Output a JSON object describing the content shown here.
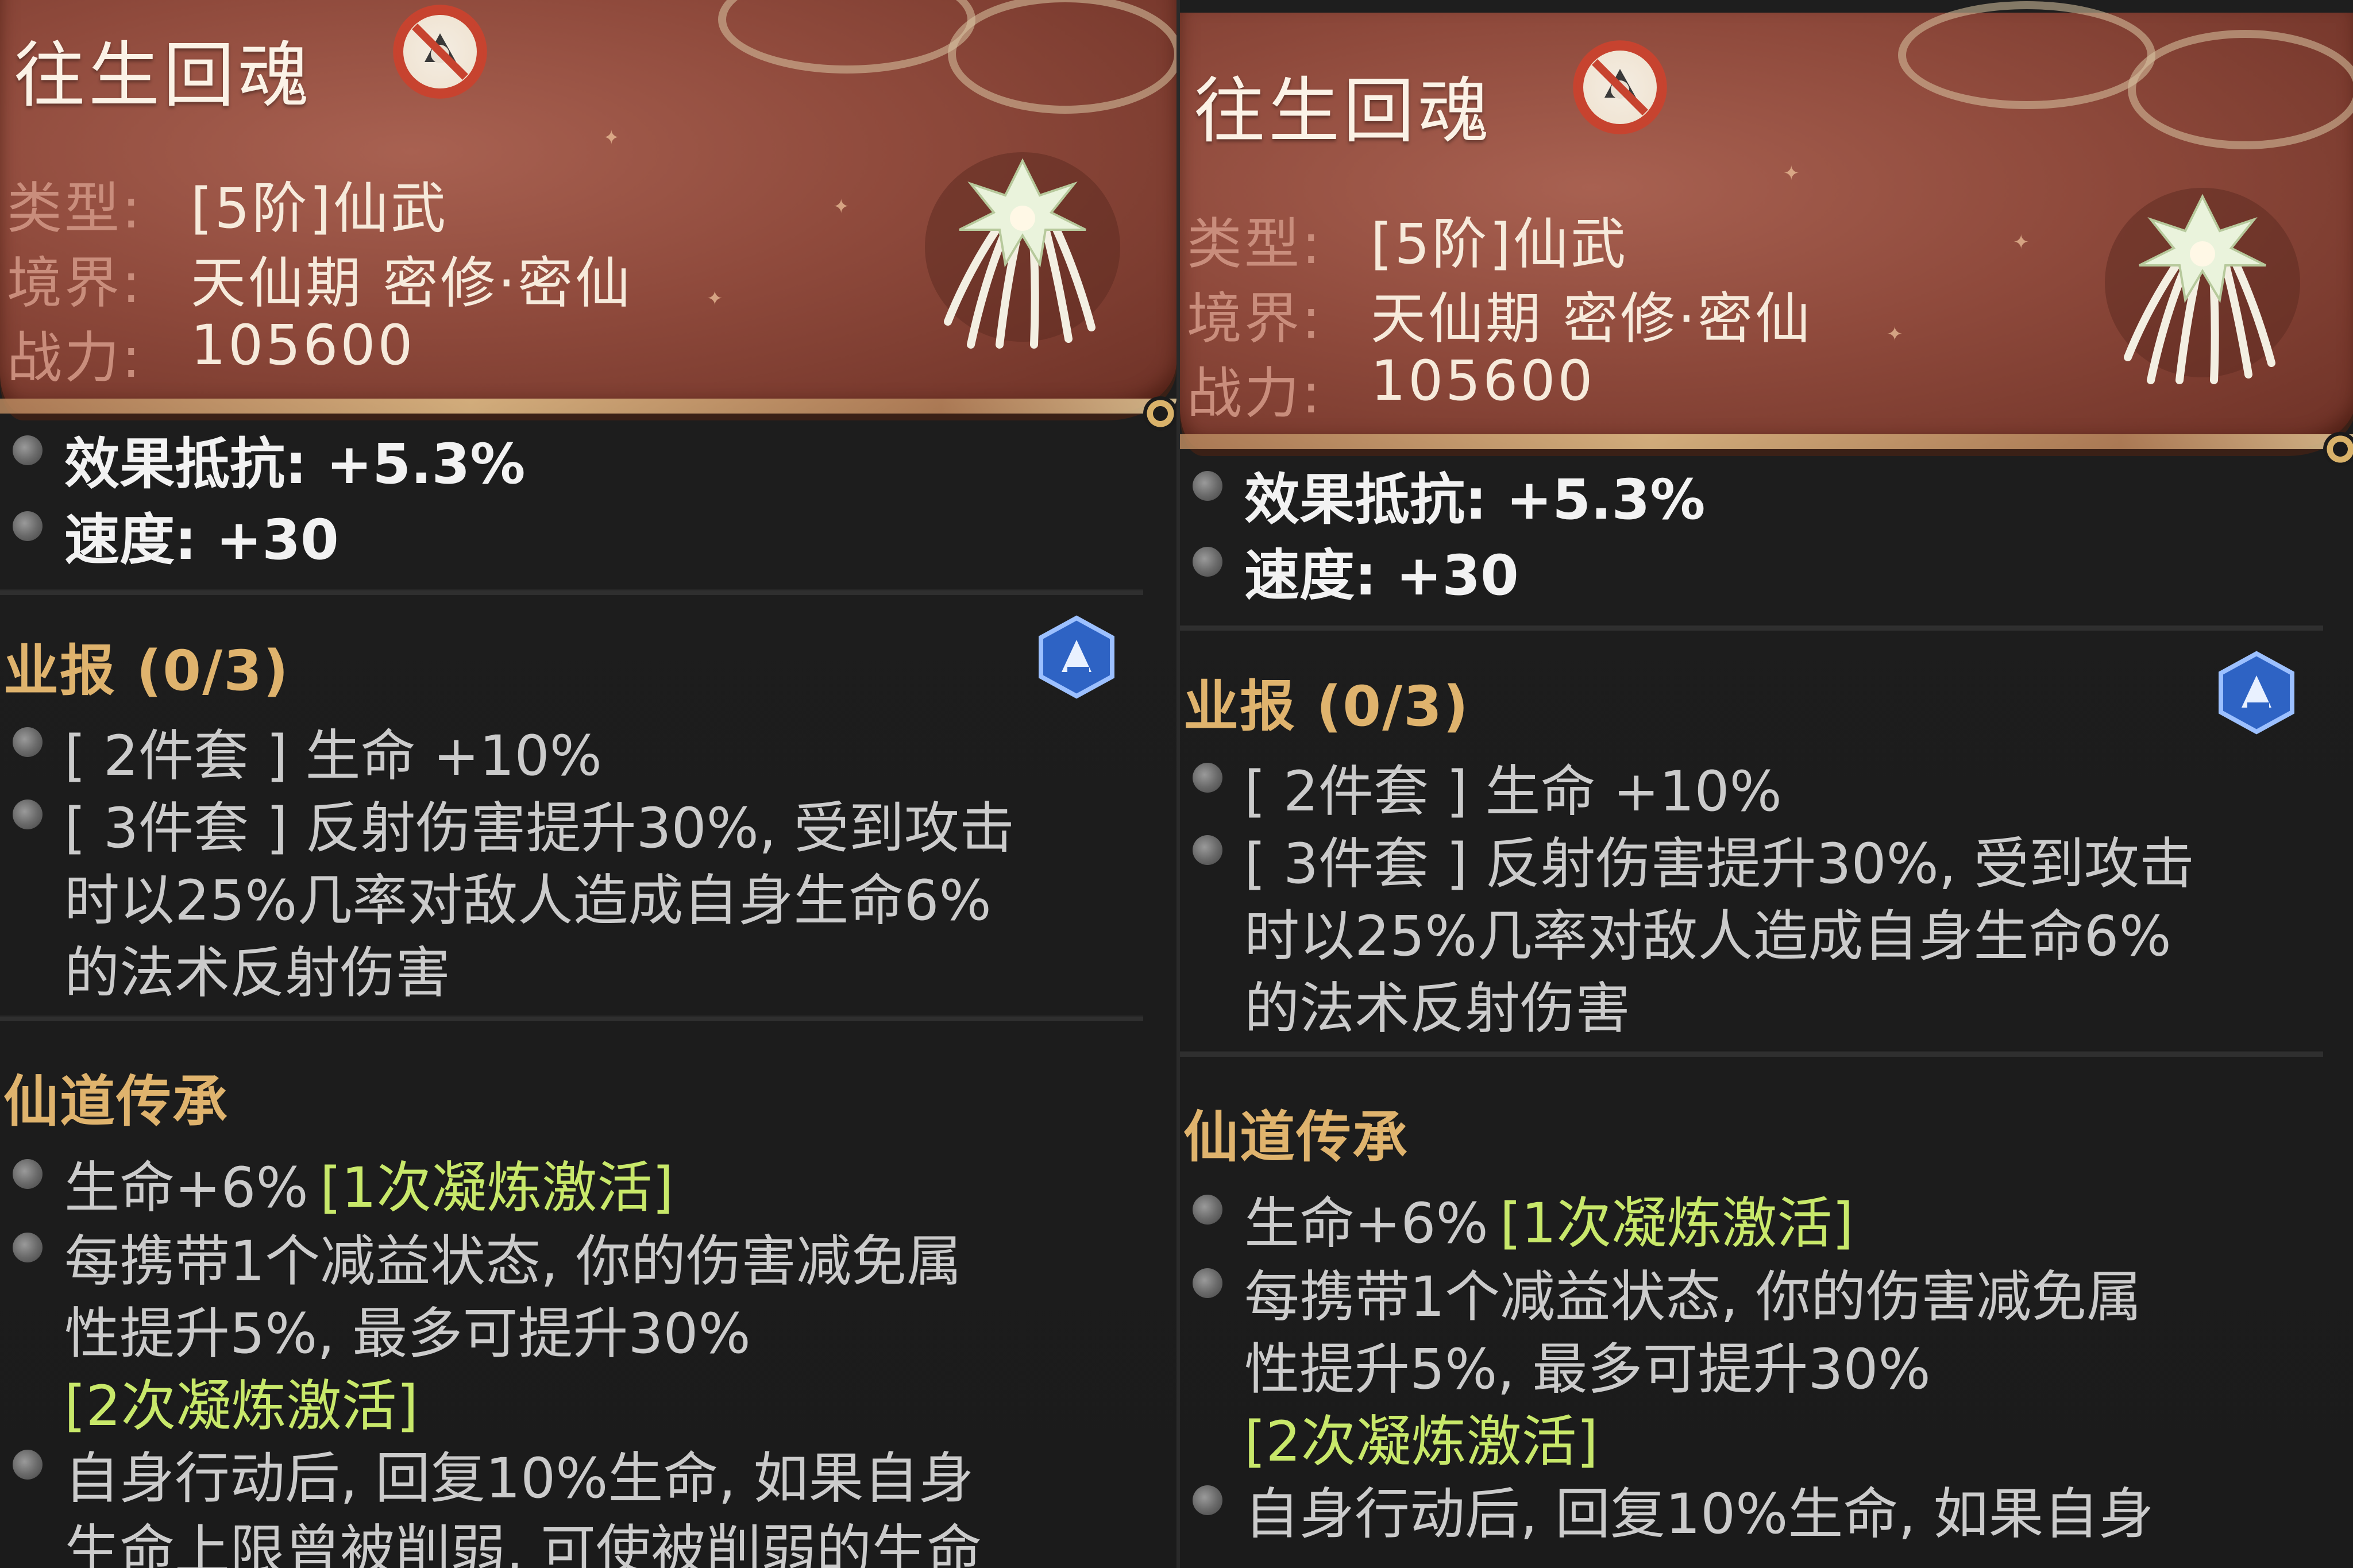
{
  "item": {
    "name": "往生回魂",
    "type_label": "类型:",
    "type_value": "[5阶]仙武",
    "realm_label": "境界:",
    "realm_value": "天仙期 密修·密仙",
    "power_label": "战力:",
    "power_value": "105600"
  },
  "stats": [
    {
      "text": "效果抵抗: +5.3%"
    },
    {
      "text": "速度: +30"
    }
  ],
  "karma": {
    "title": "业报 (0/3)",
    "set2": "[ 2件套 ] 生命 +10%",
    "set3_line1": "[ 3件套 ] 反射伤害提升30%, 受到攻击",
    "set3_line2": "时以25%几率对敌人造成自身生命6%",
    "set3_line3": "的法术反射伤害"
  },
  "inheritance": {
    "title": "仙道传承",
    "item1_text": "生命+6%",
    "item1_tag": "[1次凝炼激活]",
    "item2_line1": "每携带1个减益状态, 你的伤害减免属",
    "item2_line2": "性提升5%, 最多可提升30%",
    "item2_tag": "[2次凝炼激活]",
    "item3_line1": "自身行动后, 回复10%生命, 如果自身",
    "item3_line2": "生命上限曾被削弱, 可使被削弱的生命"
  },
  "icons": {
    "bound_seal": "no-trade-seal-icon",
    "equipment": "white-crest-weapon-icon",
    "karma_badge": "blue-karma-badge-icon",
    "bullet": "grey-bullet-icon"
  },
  "colors": {
    "header": "#8f4a3c",
    "label": "#c98d7c",
    "section_title": "#dfb36d",
    "activate_tag": "#c8e86a",
    "body_text": "#e8e8e8",
    "background": "#1b1b1b"
  }
}
